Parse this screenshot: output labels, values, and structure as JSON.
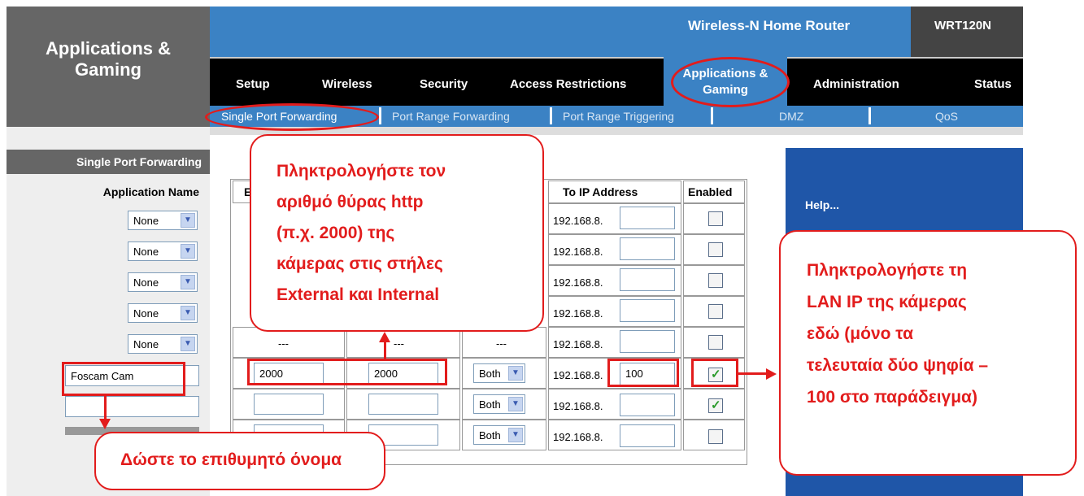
{
  "header": {
    "page_title_line1": "Applications &",
    "page_title_line2": "Gaming",
    "product_name": "Wireless-N Home Router",
    "model": "WRT120N"
  },
  "nav": {
    "tabs": [
      "Setup",
      "Wireless",
      "Security",
      "Access Restrictions",
      "Applications &",
      "Gaming",
      "Administration",
      "Status"
    ],
    "subtabs": [
      "Single Port Forwarding",
      "Port Range Forwarding",
      "Port Range Triggering",
      "DMZ",
      "QoS"
    ]
  },
  "sidebar": {
    "section_title": "Single Port Forwarding",
    "app_name_label": "Application Name",
    "select_value": "None",
    "custom_name": "Foscam Cam"
  },
  "table": {
    "col_first_partial": "E",
    "col_to_ip": "To IP Address",
    "col_enabled": "Enabled",
    "ip_prefix": "192.168.8.",
    "dash": "---",
    "external_port": "2000",
    "internal_port": "2000",
    "protocol": "Both",
    "ip_last": "100"
  },
  "help": {
    "title": "Help..."
  },
  "annotations": {
    "port_note": [
      "Πληκτρολογήστε τον",
      "αριθμό θύρας http",
      "(π.χ. 2000) της",
      "κάμερας στις στήλες",
      "External και Internal"
    ],
    "ip_note": [
      "Πληκτρολογήστε τη",
      "LAN IP της κάμερας",
      "εδώ (μόνο τα",
      "τελευταία δύο ψηφία –",
      "100 στο παράδειγμα)"
    ],
    "name_note": "Δώστε το επιθυμητό όνομα"
  },
  "colors": {
    "router_blue": "#3b82c4",
    "header_gray": "#666666",
    "annotation_red": "#e21c1c",
    "help_blue": "#1f56a8"
  }
}
